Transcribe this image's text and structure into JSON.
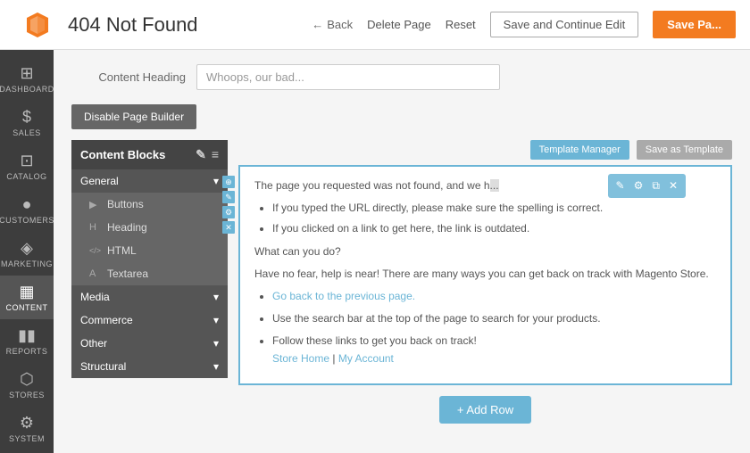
{
  "header": {
    "title": "404 Not Found",
    "back_label": "Back",
    "delete_label": "Delete Page",
    "reset_label": "Reset",
    "save_continue_label": "Save and Continue Edit",
    "save_label": "Save Pa..."
  },
  "nav": {
    "items": [
      {
        "id": "dashboard",
        "label": "Dashboard",
        "icon": "⊞"
      },
      {
        "id": "sales",
        "label": "Sales",
        "icon": "$"
      },
      {
        "id": "catalog",
        "label": "Catalog",
        "icon": "⊡"
      },
      {
        "id": "customers",
        "label": "Customers",
        "icon": "👤"
      },
      {
        "id": "marketing",
        "label": "Marketing",
        "icon": "📢"
      },
      {
        "id": "content",
        "label": "Content",
        "icon": "▦",
        "active": true
      },
      {
        "id": "reports",
        "label": "Reports",
        "icon": "📊"
      },
      {
        "id": "stores",
        "label": "Stores",
        "icon": "🏪"
      },
      {
        "id": "system",
        "label": "System",
        "icon": "⚙"
      }
    ]
  },
  "content_heading": {
    "label": "Content Heading",
    "value": "Whoops, our bad..."
  },
  "disable_btn": "Disable Page Builder",
  "sidebar": {
    "title": "Content Blocks",
    "groups": [
      {
        "label": "General",
        "items": [
          {
            "icon": "▶",
            "label": "Buttons"
          },
          {
            "icon": "H",
            "label": "Heading"
          },
          {
            "icon": "</>",
            "label": "HTML"
          },
          {
            "icon": "A",
            "label": "Textarea"
          }
        ]
      },
      {
        "label": "Media",
        "items": []
      },
      {
        "label": "Commerce",
        "items": []
      },
      {
        "label": "Other",
        "items": []
      },
      {
        "label": "Structural",
        "items": []
      }
    ]
  },
  "editor": {
    "template_manager_label": "Template Manager",
    "save_as_template_label": "Save as Template",
    "content": {
      "intro": "The page you requested was not found, and we h...",
      "bullets": [
        "If you typed the URL directly, please make sure the spelling is correct.",
        "If you clicked on a link to get here, the link is outdated."
      ],
      "what_can_you_do": "What can you do?",
      "help_text": "Have no fear, help is near! There are many ways you can get back on track with Magento Store.",
      "back_link_text": "Go back to the previous page.",
      "search_text": "Use the search bar at the top of the page to search for your products.",
      "follow_text": "Follow these links to get you back on track!",
      "store_home": "Store Home",
      "separator": "|",
      "my_account": "My Account"
    },
    "add_row_label": "+ Add Row"
  }
}
